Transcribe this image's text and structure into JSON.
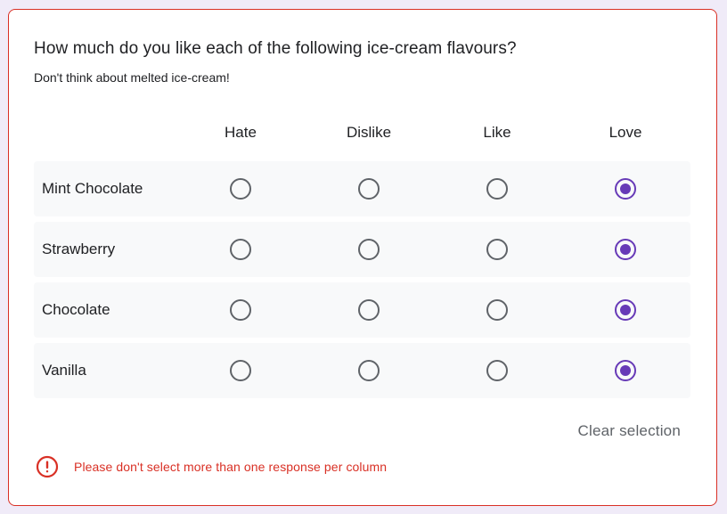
{
  "question": {
    "title": "How much do you like each of the following ice-cream flavours?",
    "description": "Don't think about melted ice-cream!"
  },
  "columns": [
    "Hate",
    "Dislike",
    "Like",
    "Love"
  ],
  "rows": [
    {
      "label": "Mint Chocolate",
      "selected": "Love"
    },
    {
      "label": "Strawberry",
      "selected": "Love"
    },
    {
      "label": "Chocolate",
      "selected": "Love"
    },
    {
      "label": "Vanilla",
      "selected": "Love"
    }
  ],
  "clear_label": "Clear selection",
  "error": {
    "message": "Please don't select more than one response per column",
    "icon": "error-icon"
  },
  "colors": {
    "accent": "#673ab7",
    "error": "#d93025",
    "background": "#f0ebf8"
  }
}
